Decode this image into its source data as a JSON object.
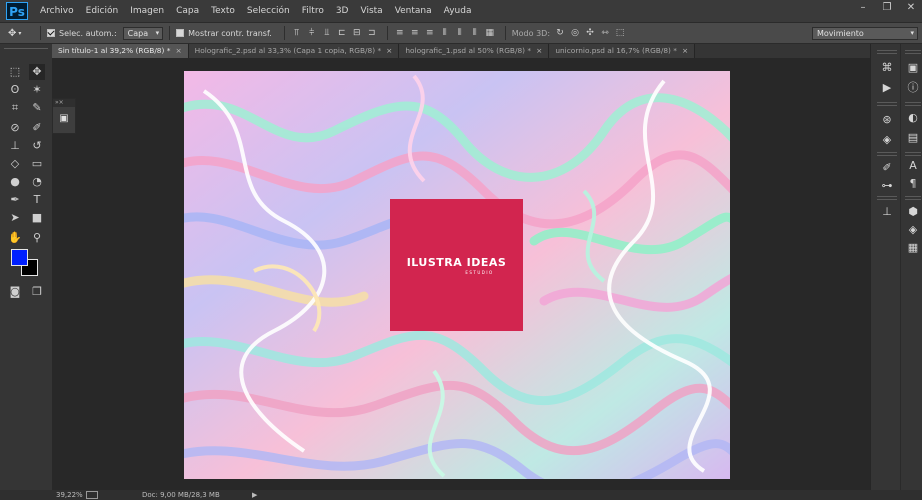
{
  "app": {
    "logo": "Ps",
    "window_controls": [
      "minimize",
      "restore",
      "close"
    ]
  },
  "menu": [
    "Archivo",
    "Edición",
    "Imagen",
    "Capa",
    "Texto",
    "Selección",
    "Filtro",
    "3D",
    "Vista",
    "Ventana",
    "Ayuda"
  ],
  "options_bar": {
    "auto_select_label": "Selec. autom.:",
    "auto_select_target": "Capa",
    "show_transform_label": "Mostrar contr. transf.",
    "mode3d_label": "Modo 3D:",
    "workspace": "Movimiento"
  },
  "tabs": [
    {
      "label": "Sin título-1 al 39,2% (RGB/8) *",
      "active": true
    },
    {
      "label": "Holografic_2.psd al 33,3% (Capa 1 copia, RGB/8) *",
      "active": false
    },
    {
      "label": "holografic_1.psd al 50% (RGB/8) *",
      "active": false
    },
    {
      "label": "unicornio.psd al 16,7% (RGB/8) *",
      "active": false
    }
  ],
  "canvas": {
    "logo_text": "ILUSTRA IDEAS",
    "logo_sub": "ESTUDIO",
    "logo_color": "#d2254f"
  },
  "colors": {
    "foreground": "#0020ff",
    "background": "#000000"
  },
  "status": {
    "zoom": "39,22%",
    "doc": "Doc: 9,00 MB/28,3 MB"
  }
}
